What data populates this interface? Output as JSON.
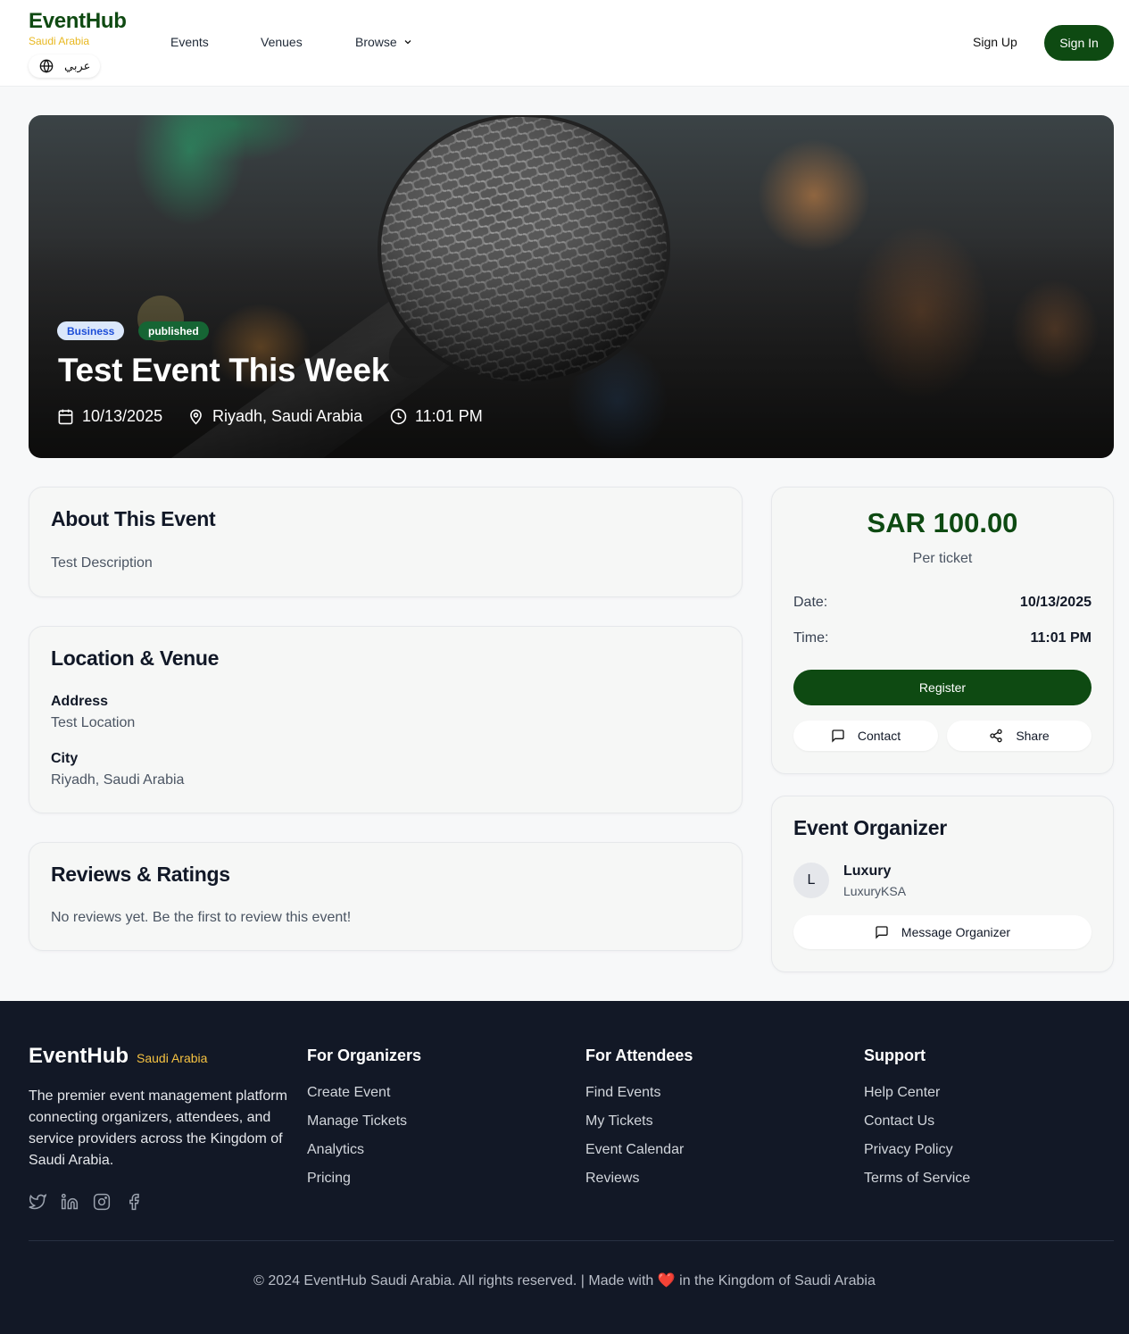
{
  "header": {
    "brand": "EventHub",
    "country": "Saudi Arabia",
    "language": "عربي",
    "nav": {
      "events": "Events",
      "venues": "Venues",
      "browse": "Browse"
    },
    "sign_up": "Sign Up",
    "sign_in": "Sign In"
  },
  "hero": {
    "category": "Business",
    "status": "published",
    "title": "Test Event This Week",
    "date": "10/13/2025",
    "location": "Riyadh, Saudi Arabia",
    "time": "11:01 PM"
  },
  "about": {
    "heading": "About This Event",
    "description": "Test Description"
  },
  "location": {
    "heading": "Location & Venue",
    "address_label": "Address",
    "address_value": "Test Location",
    "city_label": "City",
    "city_value": "Riyadh, Saudi Arabia"
  },
  "reviews": {
    "heading": "Reviews & Ratings",
    "empty": "No reviews yet. Be the first to review this event!"
  },
  "ticket": {
    "price": "SAR 100.00",
    "per": "Per ticket",
    "date_label": "Date:",
    "date_value": "10/13/2025",
    "time_label": "Time:",
    "time_value": "11:01 PM",
    "register": "Register",
    "contact": "Contact",
    "share": "Share"
  },
  "organizer": {
    "heading": "Event Organizer",
    "initial": "L",
    "name": "Luxury",
    "handle": "LuxuryKSA",
    "message": "Message Organizer"
  },
  "footer": {
    "brand": "EventHub",
    "country": "Saudi Arabia",
    "description": "The premier event management platform connecting organizers, attendees, and service providers across the Kingdom of Saudi Arabia.",
    "social_icons": [
      "twitter-icon",
      "linkedin-icon",
      "instagram-icon",
      "facebook-icon"
    ],
    "columns": [
      {
        "title": "For Organizers",
        "links": [
          "Create Event",
          "Manage Tickets",
          "Analytics",
          "Pricing"
        ]
      },
      {
        "title": "For Attendees",
        "links": [
          "Find Events",
          "My Tickets",
          "Event Calendar",
          "Reviews"
        ]
      },
      {
        "title": "Support",
        "links": [
          "Help Center",
          "Contact Us",
          "Privacy Policy",
          "Terms of Service"
        ]
      }
    ],
    "copyright": "© 2024 EventHub Saudi Arabia. All rights reserved. | Made with ❤️ in the Kingdom of Saudi Arabia"
  },
  "colors": {
    "brand_green": "#0e4a12",
    "accent_gold": "#e8b820",
    "footer_bg": "#121826",
    "badge_blue_bg": "#dbe7fb",
    "badge_green_bg": "#166534"
  }
}
